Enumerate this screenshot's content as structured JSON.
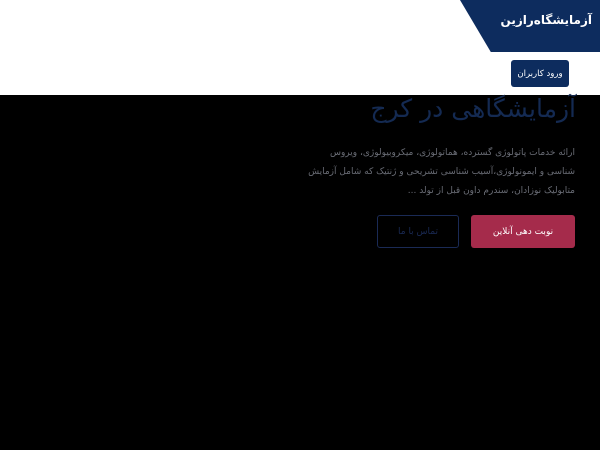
{
  "header": {
    "brand": "آزمایشگاه‌رازین",
    "login_label": "ورود کاربران"
  },
  "hero": {
    "title": "آزمایشگاهی در کرج",
    "description": "ارائه خدمات پاتولوژی گسترده، هماتولوژی، میکروبیولوژی، ویروس شناسی و ایمونولوژی،آسیب شناسی تشریحی و ژنتیک که شامل آزمایش متابولیک نوزادان، سندرم داون قبل از تولد ...",
    "primary_button": "نوبت دهی آنلاین",
    "secondary_button": "تماس با ما"
  },
  "colors": {
    "brand_navy": "#0d2c5e",
    "accent_red": "#a52b4b",
    "page_background": "#000000"
  }
}
